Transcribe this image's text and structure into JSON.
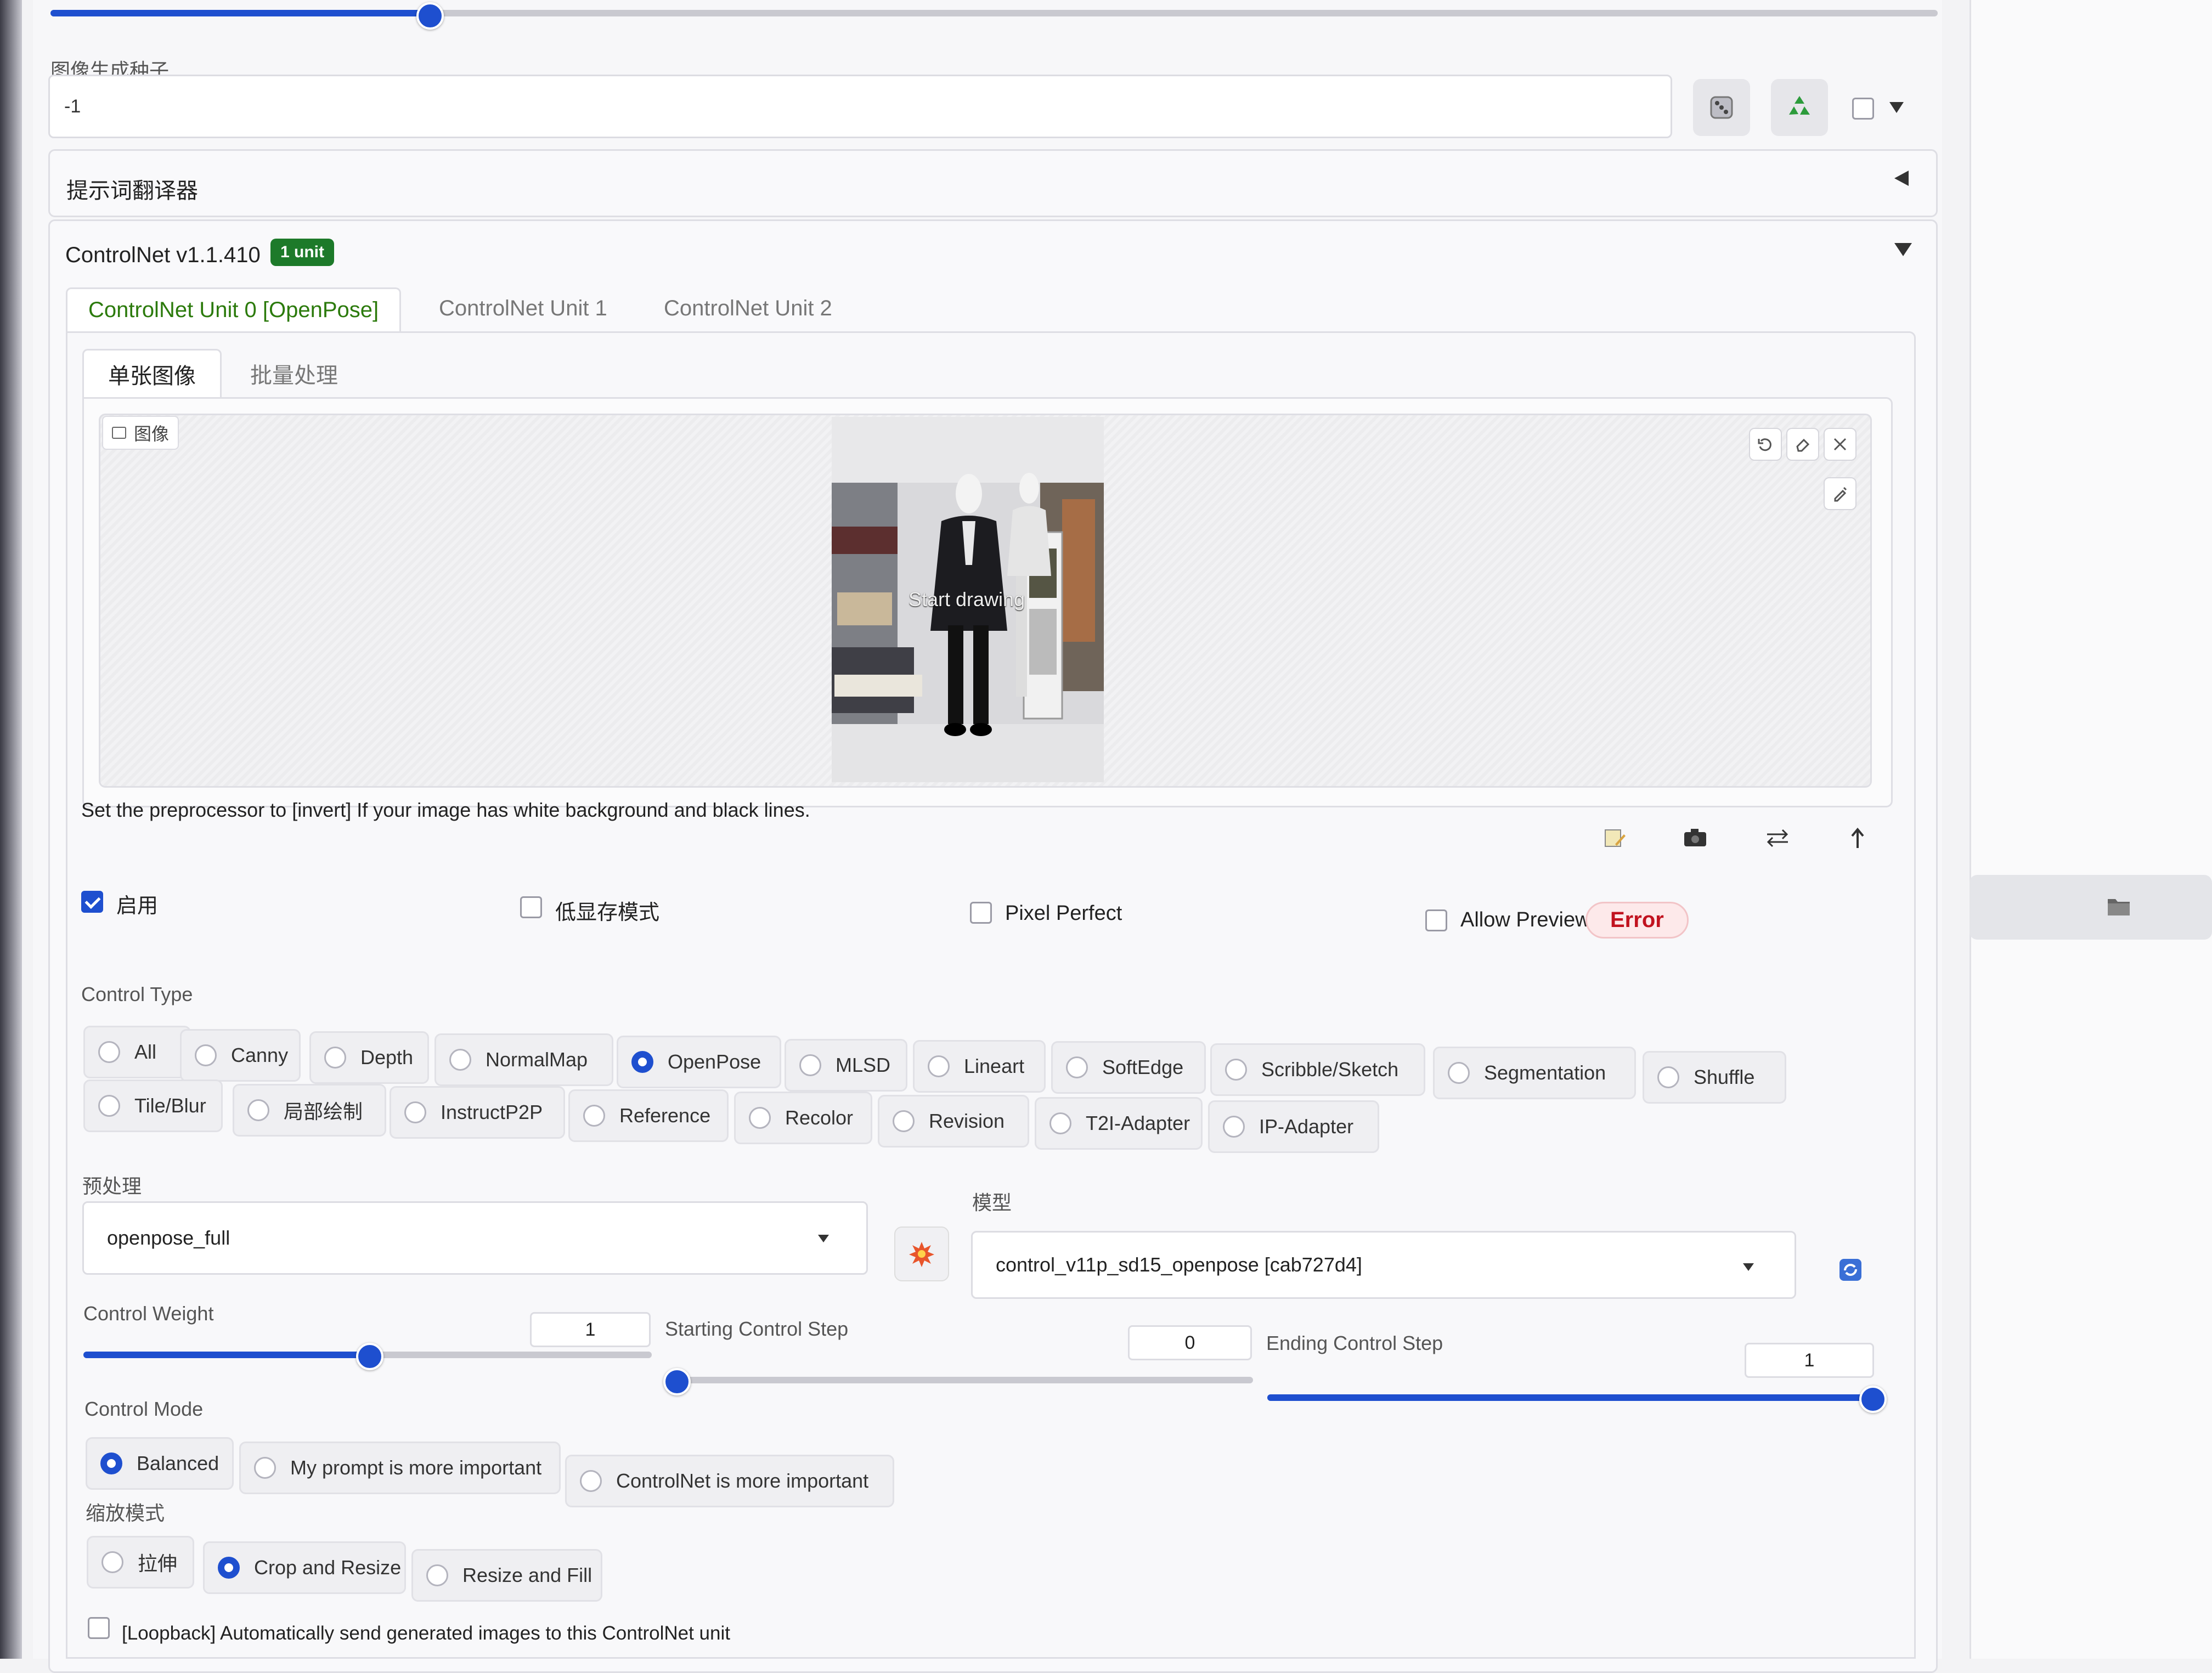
{
  "seed": {
    "label": "图像生成种子",
    "value": "-1",
    "dice_icon": "dice-icon",
    "recycle_icon": "recycle-icon"
  },
  "translator": {
    "title": "提示词翻译器"
  },
  "controlnet": {
    "title": "ControlNet v1.1.410",
    "badge": "1 unit",
    "units": [
      {
        "label": "ControlNet Unit 0 [OpenPose]",
        "active": true
      },
      {
        "label": "ControlNet Unit 1",
        "active": false
      },
      {
        "label": "ControlNet Unit 2",
        "active": false
      }
    ],
    "subtabs": [
      {
        "label": "单张图像",
        "active": true
      },
      {
        "label": "批量处理",
        "active": false
      }
    ],
    "image_label": "图像",
    "canvas_overlay": "Start drawing",
    "hint": "Set the preprocessor to [invert] If your image has white background and black lines.",
    "options": {
      "enable": {
        "label": "启用",
        "checked": true
      },
      "low_vram": {
        "label": "低显存模式",
        "checked": false
      },
      "pixel_perfect": {
        "label": "Pixel Perfect",
        "checked": false
      },
      "allow_preview": {
        "label": "Allow Preview",
        "checked": false
      },
      "error": "Error"
    },
    "control_type": {
      "label": "Control Type",
      "selected": "OpenPose",
      "row1": [
        "All",
        "Canny",
        "Depth",
        "NormalMap",
        "OpenPose",
        "MLSD",
        "Lineart",
        "SoftEdge",
        "Scribble/Sketch",
        "Segmentation",
        "Shuffle"
      ],
      "row2": [
        "Tile/Blur",
        "局部绘制",
        "InstructP2P",
        "Reference",
        "Recolor",
        "Revision",
        "T2I-Adapter",
        "IP-Adapter"
      ]
    },
    "preprocessor": {
      "label": "预处理",
      "value": "openpose_full"
    },
    "model": {
      "label": "模型",
      "value": "control_v11p_sd15_openpose [cab727d4]"
    },
    "control_weight": {
      "label": "Control Weight",
      "value": "1",
      "fraction": 0.5
    },
    "starting_step": {
      "label": "Starting Control Step",
      "value": "0",
      "fraction": 0.0
    },
    "ending_step": {
      "label": "Ending Control Step",
      "value": "1",
      "fraction": 1.0
    },
    "control_mode": {
      "label": "Control Mode",
      "selected": "Balanced",
      "options": [
        "Balanced",
        "My prompt is more important",
        "ControlNet is more important"
      ]
    },
    "resize_mode": {
      "label": "缩放模式",
      "selected": "Crop and Resize",
      "options": [
        "拉伸",
        "Crop and Resize",
        "Resize and Fill"
      ]
    },
    "loopback": {
      "label": "[Loopback] Automatically send generated images to this ControlNet unit",
      "checked": false
    }
  },
  "top_slider": {
    "fraction": 0.2
  },
  "colors": {
    "accent": "#1e4fcf",
    "active_tab": "#2b7a0b",
    "badge": "#1d7a2a",
    "error": "#c1121f"
  }
}
